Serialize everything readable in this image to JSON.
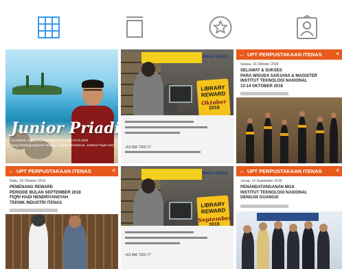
{
  "tabs": [
    {
      "name": "grid",
      "active": true,
      "color": "#3897f0"
    },
    {
      "name": "feed",
      "active": false,
      "color": "#8e8e8e"
    },
    {
      "name": "saved",
      "active": false,
      "color": "#8e8e8e"
    },
    {
      "name": "tagged",
      "active": false,
      "color": "#8e8e8e"
    }
  ],
  "posts": {
    "p1": {
      "signature": "Junior Priadi",
      "caption1": "ALUMNUS JURUSAN INFORMATIKA ANGKATAN 2008",
      "caption2": "Yang bertanggungjawab sebagai: pegawai Oficaltonal, Jurdensi Pajak Kantor Wilayah Sumatera Selatan dan Kepulauan Bangka Belitung"
    },
    "p2": {
      "brand": "itenas library",
      "badge_line1": "LIBRARY",
      "badge_line2": "REWARD",
      "badge_month": "Oktober",
      "badge_year": "2018",
      "phone": "+62 896 7260 77"
    },
    "p3": {
      "header": "UPT PERPUSTAKAAN ITENAS",
      "date": "Selasa, 16 Oktober 2018",
      "title1": "SELAMAT & SUKSES",
      "title2": "PARA WISUDA SARJANA & MAGISTER",
      "title3": "INSTITUT TEKNOLOGI NASIONAL",
      "title4": "13-14 OKTOBER 2018"
    },
    "p4": {
      "header": "UPT PERPUSTAKAAN ITENAS",
      "date": "Rabu, 03 Oktober 2018",
      "title1": "PEMENANG REWARD",
      "title2": "PERIODE BULAN SEPTEMBER 2018",
      "title3": "FIQRI HADI HENDRIYANSYAH",
      "title4": "TEKNIK INDUSTRI ITENAS"
    },
    "p5": {
      "brand": "itenas library",
      "badge_line1": "LIBRARY",
      "badge_line2": "REWARD",
      "badge_month": "September",
      "badge_year": "2018",
      "phone": "+62 896 7260 77"
    },
    "p6": {
      "header": "UPT PERPUSTAKAAN ITENAS",
      "date": "Jumat, 14 September 2018",
      "title1": "PENANDATANGANAN MOA",
      "title2": "INSTITUT TEKNOLOGI NASIONAL",
      "title3": "DENGAN GUANGXI"
    }
  }
}
